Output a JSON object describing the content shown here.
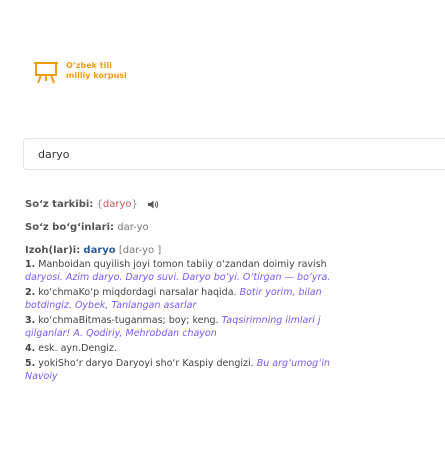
{
  "brand": {
    "line1": "O‘zbek tili",
    "line2": "milliy korpusi",
    "color": "#f39c12"
  },
  "search": {
    "value": "daryo"
  },
  "entry": {
    "structure_label": "So‘z tarkibi:",
    "structure_open": "{",
    "structure_value": "daryo",
    "structure_close": "}",
    "syllables_label": "So‘z bo‘g‘inlari:",
    "syllables_value": "dar-yo",
    "meanings_label": "Izoh(lar)i:",
    "meanings_word": "daryo",
    "meanings_syllables": "[dar-yo ]",
    "senses": [
      {
        "num": "1.",
        "def": "Manboidan quyilish joyi tomon tabiiy o‘zandan doimiy ravish",
        "example": "daryosi. Azim daryo. Daryo suvi. Daryo bo‘yi. O‘tirgan — bo‘yra."
      },
      {
        "num": "2.",
        "def": "ko‘chmaKo‘p miqdordagi narsalar haqida.",
        "example_inline": "Botir yorim, bilan",
        "example": "botdingiz. Oybek, Tanlangan asarlar"
      },
      {
        "num": "3.",
        "def": "ko‘chmaBitmas-tuganmas; boy; keng.",
        "example_inline": "Taqsirimning ilmlari j",
        "example": "qilganlar! A. Qodiriy, Mehrobdan chayon"
      },
      {
        "num": "4.",
        "def": "esk. ayn.Dengiz."
      },
      {
        "num": "5.",
        "def": "yokiSho‘r daryo Daryoyi sho‘r Kaspiy dengizi.",
        "example_inline": "Bu arg‘umog‘in",
        "example": "Navoiy"
      }
    ]
  }
}
